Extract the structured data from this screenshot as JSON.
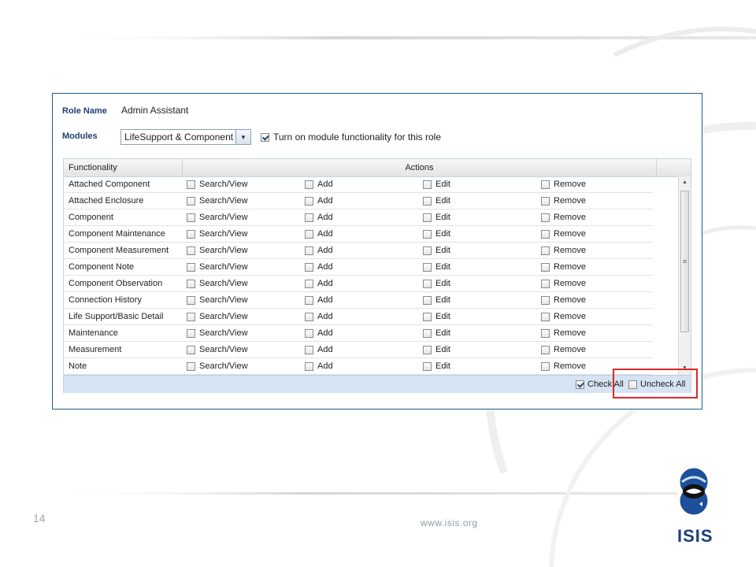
{
  "form": {
    "role_name_label": "Role Name",
    "role_name_value": "Admin Assistant",
    "modules_label": "Modules",
    "modules_selected": "LifeSupport & Component",
    "module_toggle_label": "Turn on module functionality for this role",
    "module_toggle_checked": true
  },
  "grid": {
    "columns": {
      "functionality": "Functionality",
      "actions": "Actions"
    },
    "action_labels": [
      "Search/View",
      "Add",
      "Edit",
      "Remove"
    ],
    "rows": [
      "Attached Component",
      "Attached Enclosure",
      "Component",
      "Component Maintenance",
      "Component Measurement",
      "Component Note",
      "Component Observation",
      "Connection History",
      "Life Support/Basic Detail",
      "Maintenance",
      "Measurement",
      "Note"
    ]
  },
  "footer": {
    "check_all_label": "Check All",
    "check_all_checked": true,
    "uncheck_all_label": "Uncheck All",
    "uncheck_all_checked": false
  },
  "slide": {
    "page_number": "14",
    "url": "www.isis.org",
    "logo_text": "ISIS"
  },
  "colors": {
    "panel_border": "#1f5a8c",
    "label_text": "#1f3f73",
    "footer_bar": "#d5e3f2",
    "highlight": "#e0262a",
    "logo": "#1b3f78"
  }
}
